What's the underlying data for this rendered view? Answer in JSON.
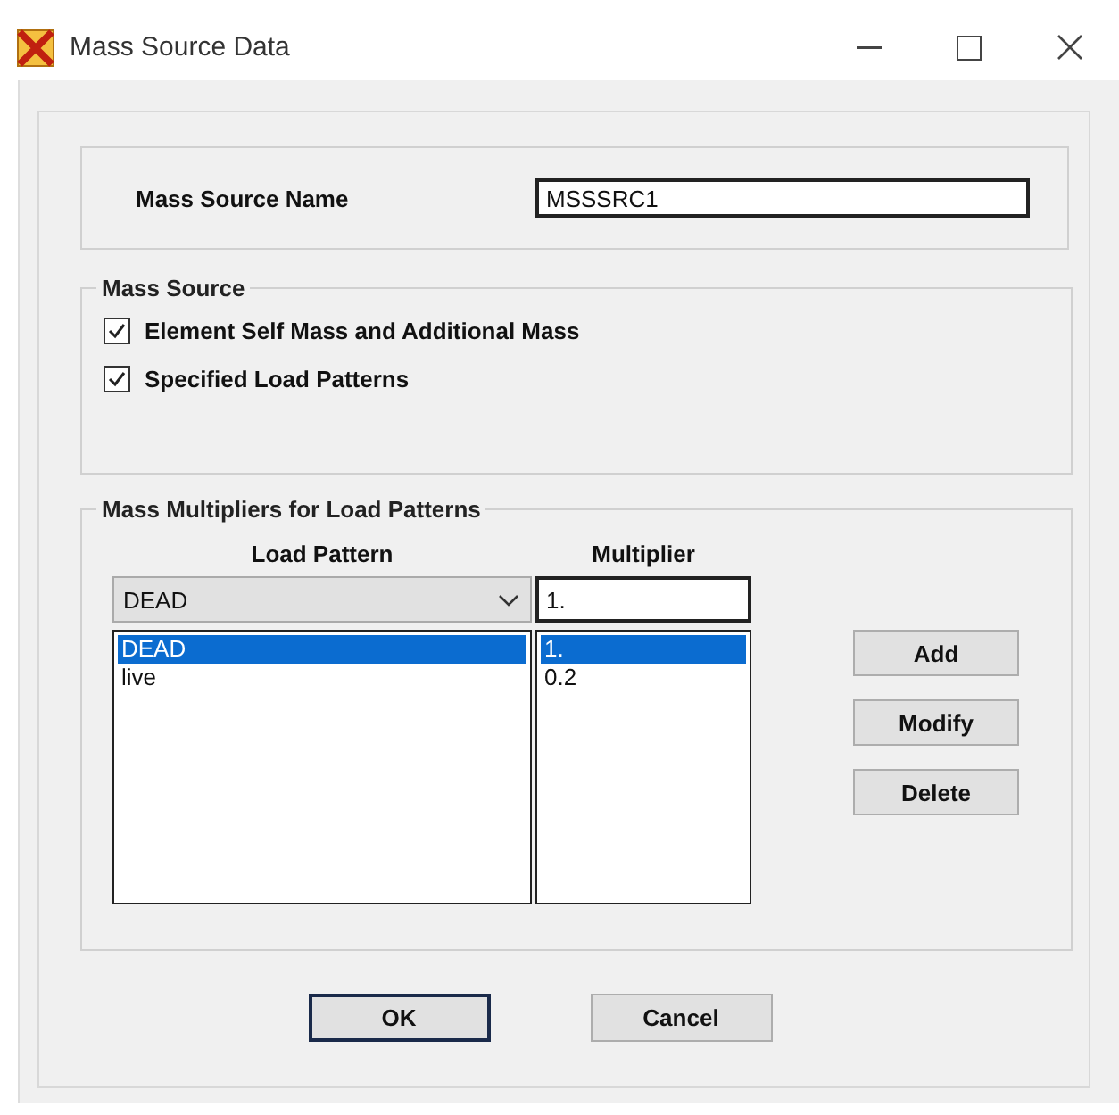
{
  "window": {
    "title": "Mass Source Data"
  },
  "mass_source_name": {
    "label": "Mass Source Name",
    "value": "MSSSRC1"
  },
  "mass_source": {
    "title": "Mass Source",
    "options": [
      {
        "label": "Element Self Mass and Additional Mass",
        "checked": true
      },
      {
        "label": "Specified Load Patterns",
        "checked": true
      }
    ]
  },
  "multipliers": {
    "title": "Mass Multipliers for Load Patterns",
    "columns": [
      "Load Pattern",
      "Multiplier"
    ],
    "load_pattern_value": "DEAD",
    "multiplier_value": "1.",
    "rows": [
      {
        "load_pattern": "DEAD",
        "multiplier": "1.",
        "selected": true
      },
      {
        "load_pattern": "live",
        "multiplier": "0.2",
        "selected": false
      }
    ],
    "buttons": [
      "Add",
      "Modify",
      "Delete"
    ]
  },
  "buttons": [
    {
      "label": "OK",
      "default": true
    },
    {
      "label": "Cancel",
      "default": false
    }
  ]
}
